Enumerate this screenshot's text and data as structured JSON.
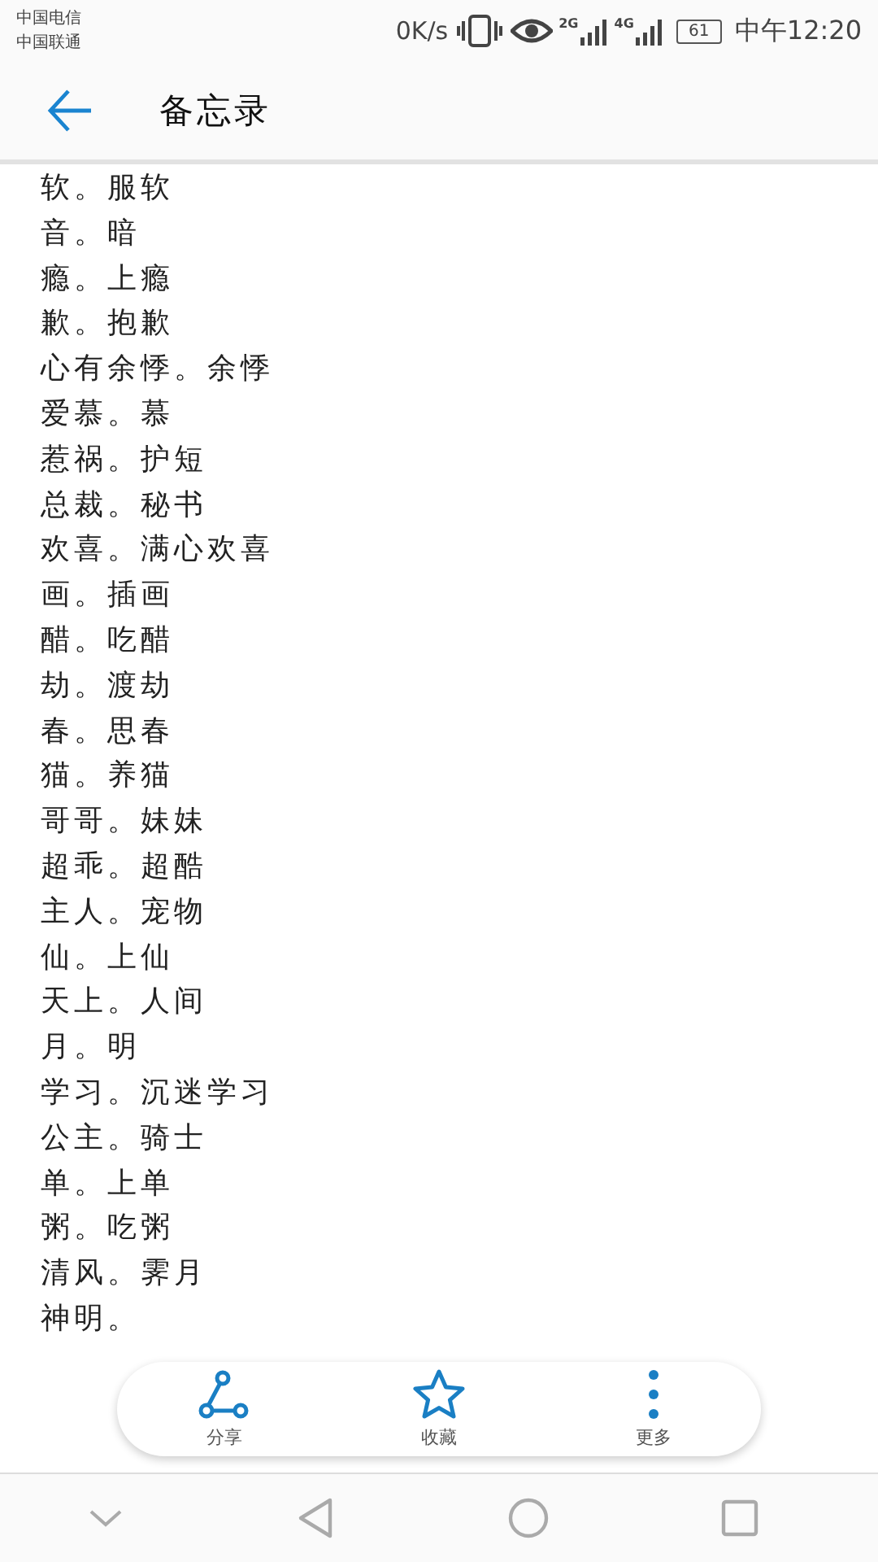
{
  "status_bar": {
    "carriers": [
      "中国电信",
      "中国联通"
    ],
    "speed": "0K/s",
    "networks": [
      "2G",
      "4G"
    ],
    "battery": "61",
    "time": "中午12:20"
  },
  "header": {
    "title": "备忘录"
  },
  "lines": [
    "软。服软",
    "音。暗",
    "瘾。上瘾",
    "歉。抱歉",
    "心有余悸。余悸",
    "爱慕。慕",
    "惹祸。护短",
    "总裁。秘书",
    "欢喜。满心欢喜",
    "画。插画",
    "醋。吃醋",
    "劫。渡劫",
    "春。思春",
    "猫。养猫",
    "哥哥。妹妹",
    "超乖。超酷",
    "主人。宠物",
    "仙。上仙",
    "天上。人间",
    "月。明",
    "学习。沉迷学习",
    "公主。骑士",
    "单。上单",
    "粥。吃粥",
    "清风。霁月",
    "神明。"
  ],
  "toolbar": [
    {
      "kind": "share",
      "label": "分享"
    },
    {
      "kind": "star",
      "label": "收藏"
    },
    {
      "kind": "more",
      "label": "更多"
    }
  ]
}
